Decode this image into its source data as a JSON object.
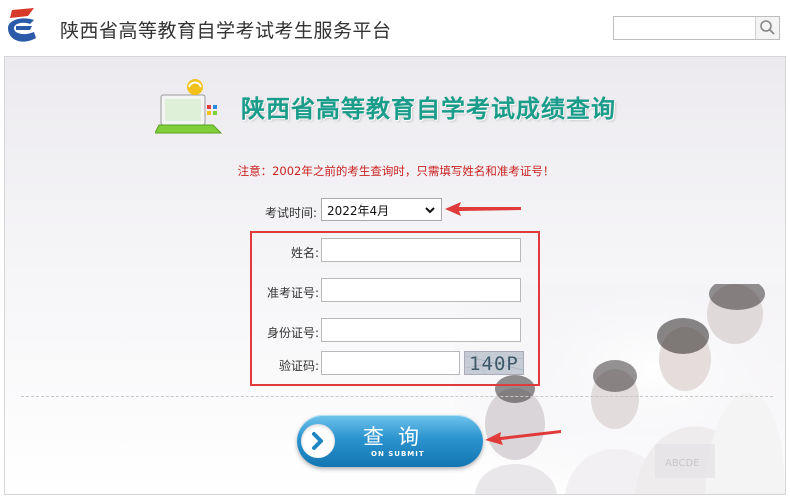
{
  "header": {
    "site_title": "陕西省高等教育自学考试考生服务平台",
    "search_placeholder": ""
  },
  "banner": {
    "title": "陕西省高等教育自学考试成绩查询"
  },
  "notice": "注意：2002年之前的考生查询时，只需填写姓名和准考证号！",
  "form": {
    "exam_time_label": "考试时间:",
    "exam_time_value": "2022年4月",
    "name_label": "姓名:",
    "name_value": "",
    "ticket_label": "准考证号:",
    "ticket_value": "",
    "idcard_label": "身份证号:",
    "idcard_value": "",
    "captcha_label": "验证码:",
    "captcha_value": "",
    "captcha_image_text": "140P"
  },
  "submit": {
    "label": "查询",
    "sublabel": "ON SUBMIT"
  },
  "colors": {
    "accent_title": "#1a9c8a",
    "notice_red": "#cc2222",
    "annotation_red": "#e03a3a",
    "button_blue": "#2b93cf"
  },
  "icons": [
    "logo-icon",
    "search-icon",
    "computer-illustration-icon",
    "dropdown-arrow-icon",
    "chevron-right-icon",
    "annotation-arrow-icon"
  ]
}
